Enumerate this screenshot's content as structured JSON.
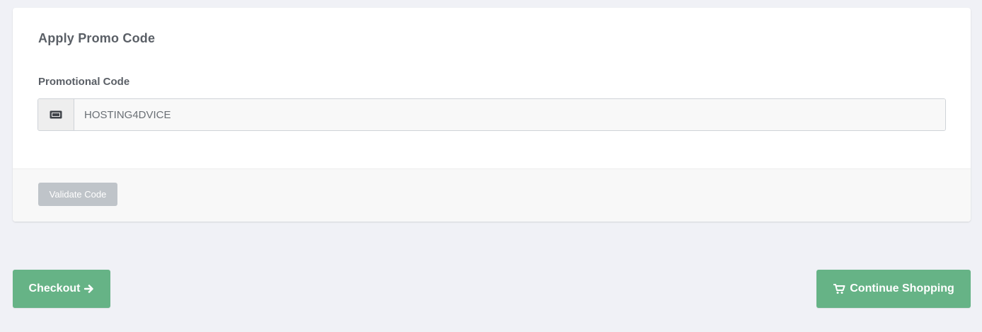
{
  "promo": {
    "title": "Apply Promo Code",
    "field_label": "Promotional Code",
    "input_value": "HOSTING4DVICE",
    "input_icon": "ticket-icon",
    "validate_label": "Validate Code"
  },
  "actions": {
    "checkout_label": "Checkout",
    "checkout_icon": "arrow-right-icon",
    "continue_label": "Continue Shopping",
    "continue_icon": "cart-icon"
  },
  "colors": {
    "page_background": "#f0f1f6",
    "primary_button": "#66b386",
    "disabled_button": "#bfc4c9",
    "label_text": "#5a5f66"
  }
}
